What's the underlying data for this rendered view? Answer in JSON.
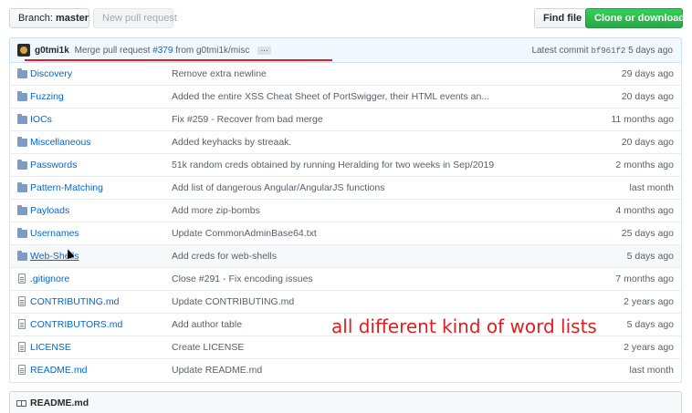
{
  "toolbar": {
    "branch_prefix": "Branch:",
    "branch_name": "master",
    "new_pull_request": "New pull request",
    "find_file": "Find file",
    "clone_or_download": "Clone or download"
  },
  "commit": {
    "author": "g0tmi1k",
    "message_prefix": "Merge pull request",
    "pr_link": "#379",
    "message_suffix": "from g0tmi1k/misc",
    "ellipsis": "…",
    "latest_label": "Latest commit",
    "sha": "bf961f2",
    "age": "5 days ago"
  },
  "files": [
    {
      "name": "Discovery",
      "type": "folder",
      "message": "Remove extra newline",
      "age": "29 days ago"
    },
    {
      "name": "Fuzzing",
      "type": "folder",
      "message": "Added the entire XSS Cheat Sheet of PortSwigger, their HTML events an...",
      "age": "20 days ago"
    },
    {
      "name": "IOCs",
      "type": "folder",
      "message": "Fix #259 - Recover from bad merge",
      "age": "11 months ago"
    },
    {
      "name": "Miscellaneous",
      "type": "folder",
      "message": "Added keyhacks by streaak.",
      "age": "20 days ago"
    },
    {
      "name": "Passwords",
      "type": "folder",
      "message": "51k random creds obtained by running Heralding for two weeks in Sep/2019",
      "age": "2 months ago"
    },
    {
      "name": "Pattern-Matching",
      "type": "folder",
      "message": "Add list of dangerous Angular/AngularJS functions",
      "age": "last month"
    },
    {
      "name": "Payloads",
      "type": "folder",
      "message": "Add more zip-bombs",
      "age": "4 months ago"
    },
    {
      "name": "Usernames",
      "type": "folder",
      "message": "Update CommonAdminBase64.txt",
      "age": "25 days ago"
    },
    {
      "name": "Web-Shells",
      "type": "folder",
      "message": "Add creds for web-shells",
      "age": "5 days ago"
    },
    {
      "name": ".gitignore",
      "type": "file",
      "message": "Close #291 - Fix encoding issues",
      "age": "7 months ago"
    },
    {
      "name": "CONTRIBUTING.md",
      "type": "file",
      "message": "Update CONTRIBUTING.md",
      "age": "2 years ago"
    },
    {
      "name": "CONTRIBUTORS.md",
      "type": "file",
      "message": "Add author table",
      "age": "5 days ago"
    },
    {
      "name": "LICENSE",
      "type": "file",
      "message": "Create LICENSE",
      "age": "2 years ago"
    },
    {
      "name": "README.md",
      "type": "file",
      "message": "Update README.md",
      "age": "last month"
    }
  ],
  "annotation": "all different kind of word lists",
  "readme": {
    "label": "README.md"
  },
  "colors": {
    "link": "#0366d6",
    "muted": "#586069",
    "accent_green": "#28a745",
    "annotation_red": "#e11d21"
  }
}
